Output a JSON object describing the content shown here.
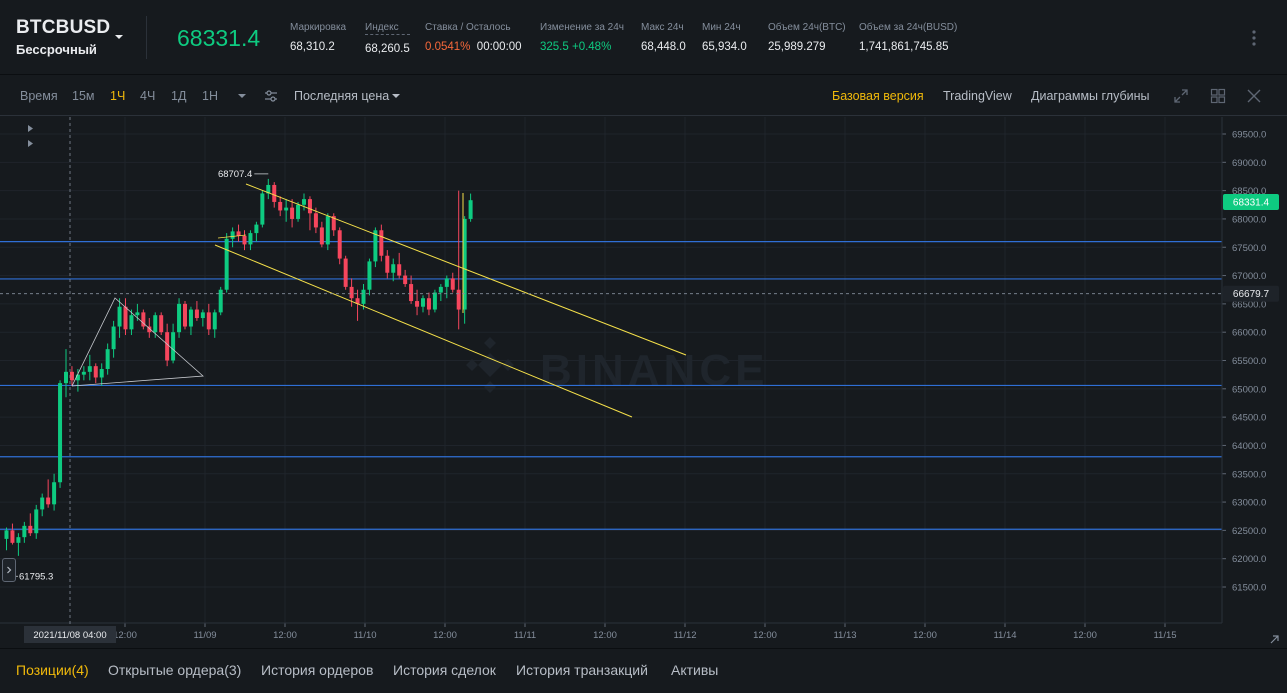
{
  "ticker": {
    "symbol": "BTCBUSD",
    "contract": "Бессрочный",
    "last_price": "68331.4",
    "stats": [
      {
        "label": "Маркировка",
        "value": "68,310.2"
      },
      {
        "label": "Индекс",
        "value": "68,260.5"
      },
      {
        "label": "Ставка / Осталось",
        "value_rate": "0.0541%",
        "value_countdown": "00:00:00"
      },
      {
        "label": "Изменение за 24ч",
        "value": "325.5 +0.48%"
      },
      {
        "label": "Макс 24ч",
        "value": "68,448.0"
      },
      {
        "label": "Мин 24ч",
        "value": "65,934.0"
      },
      {
        "label": "Объем 24ч(BTC)",
        "value": "25,989.279"
      },
      {
        "label": "Объем за 24ч(BUSD)",
        "value": "1,741,861,745.85"
      }
    ]
  },
  "toolbar": {
    "time_label": "Время",
    "intervals": [
      "15м",
      "1Ч",
      "4Ч",
      "1Д",
      "1Н"
    ],
    "active_interval": "1Ч",
    "price_type": "Последняя цена",
    "views": [
      "Базовая версия",
      "TradingView",
      "Диаграммы глубины"
    ],
    "active_view": "Базовая версия"
  },
  "colors": {
    "up": "#0ecb81",
    "down": "#f6465d",
    "accent": "#f0b90b",
    "hline": "#2f6fd6",
    "channel": "#f5e04a",
    "background": "#161a1e"
  },
  "chart_data": {
    "type": "candlestick",
    "interval": "1Ч",
    "ylim": [
      61400,
      69800
    ],
    "y_ticks": [
      61500,
      62000,
      62500,
      63000,
      63500,
      64000,
      64500,
      65000,
      65500,
      66000,
      66500,
      67000,
      67500,
      68000,
      68500,
      69000,
      69500
    ],
    "x_tick_labels": [
      "12:00",
      "11/09",
      "12:00",
      "11/10",
      "12:00",
      "11/11",
      "12:00",
      "11/12",
      "12:00",
      "11/13",
      "12:00",
      "11/14",
      "12:00",
      "11/15"
    ],
    "crosshair_time_label": "2021/11/08 04:00",
    "last_price_tag": "68331.4",
    "crosshair_price_tag": "66679.7",
    "crosshair_price": 66679.7,
    "high_marker": {
      "value": 68707.4,
      "label": "68707.4"
    },
    "low_marker": {
      "value": 61795.3,
      "label": "61795.3"
    },
    "horizontal_lines": [
      67600,
      66940,
      65060,
      63800,
      62520
    ],
    "watermark": "BINANCE",
    "candles": [
      [
        62350,
        62550,
        62150,
        62500
      ],
      [
        62500,
        62620,
        62250,
        62280
      ],
      [
        62280,
        62450,
        62050,
        62380
      ],
      [
        62380,
        62650,
        62280,
        62580
      ],
      [
        62580,
        62800,
        62400,
        62450
      ],
      [
        62450,
        62950,
        62350,
        62870
      ],
      [
        62870,
        63150,
        62750,
        63080
      ],
      [
        63080,
        63400,
        62900,
        62960
      ],
      [
        62960,
        63500,
        62850,
        63350
      ],
      [
        63350,
        65150,
        63250,
        65100
      ],
      [
        65100,
        65700,
        64850,
        65300
      ],
      [
        65300,
        65400,
        65050,
        65150
      ],
      [
        65150,
        65350,
        64950,
        65250
      ],
      [
        65250,
        65400,
        65150,
        65300
      ],
      [
        65300,
        65600,
        65150,
        65400
      ],
      [
        65400,
        65450,
        65100,
        65200
      ],
      [
        65200,
        65450,
        65050,
        65350
      ],
      [
        65350,
        65800,
        65250,
        65700
      ],
      [
        65700,
        66200,
        65550,
        66100
      ],
      [
        66100,
        66600,
        65900,
        66450
      ],
      [
        66450,
        66600,
        65950,
        66050
      ],
      [
        66050,
        66400,
        65950,
        66300
      ],
      [
        66300,
        66500,
        66200,
        66350
      ],
      [
        66350,
        66400,
        66050,
        66100
      ],
      [
        66100,
        66250,
        65900,
        66000
      ],
      [
        66000,
        66350,
        65900,
        66300
      ],
      [
        66300,
        66350,
        65950,
        66000
      ],
      [
        66000,
        66150,
        65400,
        65500
      ],
      [
        65500,
        66150,
        65450,
        66000
      ],
      [
        66000,
        66600,
        65900,
        66500
      ],
      [
        66500,
        66550,
        66050,
        66100
      ],
      [
        66100,
        66450,
        65950,
        66400
      ],
      [
        66400,
        66550,
        66200,
        66250
      ],
      [
        66250,
        66400,
        66100,
        66350
      ],
      [
        66350,
        66500,
        65950,
        66050
      ],
      [
        66050,
        66400,
        65900,
        66350
      ],
      [
        66350,
        66800,
        66300,
        66750
      ],
      [
        66750,
        67750,
        66700,
        67650
      ],
      [
        67650,
        67850,
        67500,
        67780
      ],
      [
        67780,
        67900,
        67600,
        67700
      ],
      [
        67700,
        67800,
        67450,
        67550
      ],
      [
        67550,
        67800,
        67450,
        67750
      ],
      [
        67750,
        67950,
        67600,
        67900
      ],
      [
        67900,
        68500,
        67850,
        68450
      ],
      [
        68450,
        68707,
        68350,
        68600
      ],
      [
        68600,
        68650,
        68200,
        68300
      ],
      [
        68300,
        68400,
        68050,
        68150
      ],
      [
        68150,
        68350,
        67950,
        68200
      ],
      [
        68200,
        68350,
        67850,
        68000
      ],
      [
        68000,
        68300,
        67950,
        68250
      ],
      [
        68250,
        68450,
        68150,
        68350
      ],
      [
        68350,
        68400,
        67800,
        68100
      ],
      [
        68100,
        68200,
        67750,
        67850
      ],
      [
        67850,
        67950,
        67500,
        67550
      ],
      [
        67550,
        68100,
        67450,
        68050
      ],
      [
        68050,
        68100,
        67700,
        67800
      ],
      [
        67800,
        67850,
        67200,
        67300
      ],
      [
        67300,
        67350,
        66750,
        66800
      ],
      [
        66800,
        66950,
        66450,
        66600
      ],
      [
        66600,
        66750,
        66200,
        66500
      ],
      [
        66500,
        66850,
        66400,
        66750
      ],
      [
        66750,
        67300,
        66650,
        67250
      ],
      [
        67250,
        67850,
        67150,
        67800
      ],
      [
        67800,
        67900,
        67250,
        67350
      ],
      [
        67350,
        67450,
        66950,
        67050
      ],
      [
        67050,
        67300,
        66900,
        67200
      ],
      [
        67200,
        67400,
        66950,
        67000
      ],
      [
        67000,
        67100,
        66800,
        66850
      ],
      [
        66850,
        67000,
        66500,
        66550
      ],
      [
        66550,
        66750,
        66300,
        66450
      ],
      [
        66450,
        66650,
        66350,
        66600
      ],
      [
        66600,
        66700,
        66300,
        66400
      ],
      [
        66400,
        66750,
        66350,
        66700
      ],
      [
        66700,
        66850,
        66550,
        66800
      ],
      [
        66800,
        67000,
        66600,
        66950
      ],
      [
        66950,
        67050,
        66700,
        66750
      ],
      [
        66750,
        68500,
        66050,
        66400
      ],
      [
        66400,
        68050,
        66150,
        68000
      ],
      [
        68000,
        68448,
        67950,
        68331
      ]
    ]
  },
  "bottom_tabs": [
    "Позиции(4)",
    "Открытые ордера(3)",
    "История ордеров",
    "История сделок",
    "История транзакций",
    "Активы"
  ],
  "active_bottom_tab": "Позиции(4)"
}
